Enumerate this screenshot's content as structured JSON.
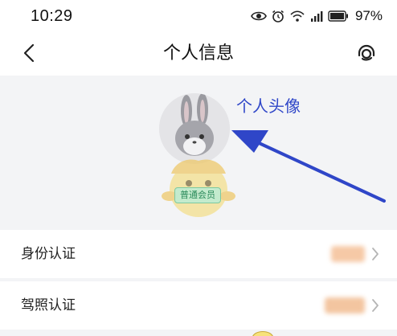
{
  "status_bar": {
    "time": "10:29",
    "battery_percent": "97%",
    "icons": [
      "eye-icon",
      "alarm-icon",
      "wifi-icon",
      "signal-icon",
      "battery-icon"
    ]
  },
  "nav": {
    "title": "个人信息",
    "back_icon": "chevron-left-icon",
    "right_icon": "headset-icon"
  },
  "profile": {
    "avatar_annotation": "个人头像",
    "member_badge": "普通会员"
  },
  "rows": [
    {
      "label": "身份认证"
    },
    {
      "label": "驾照认证"
    }
  ],
  "colors": {
    "accent_annotation": "#2f46c8",
    "section_bg": "#f3f4f6",
    "badge_green": "#2a8a5a"
  }
}
